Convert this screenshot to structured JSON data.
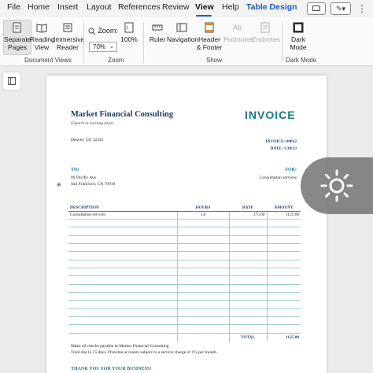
{
  "menu": {
    "items": [
      "File",
      "Home",
      "Insert",
      "Layout",
      "References",
      "Review",
      "View",
      "Help",
      "Table Design"
    ],
    "active": "View"
  },
  "ribbon": {
    "separate_pages": "Separate Pages",
    "reading_view": "Reading View",
    "immersive_reader": "Immersive Reader",
    "zoom": "Zoom:",
    "zoom_100": "100%",
    "zoom_value": "70%",
    "ruler": "Ruler",
    "navigation": "Navigation",
    "header_footer": "Header & Footer",
    "footnotes": "Footnotes",
    "endnotes": "Endnotes",
    "dark_mode": "Dark Mode",
    "groups": {
      "document_views": "Document Views",
      "zoom": "Zoom",
      "show": "Show",
      "dark_mode": "Dark Mode"
    }
  },
  "invoice": {
    "company": "Market Financial Consulting",
    "tagline": "Experts in earning trusts",
    "title": "INVOICE",
    "address": "Denver, CO 12345",
    "invoice_no": "INVOICE: 00012",
    "date": "DATE: 1/30/23",
    "to_label": "TO:",
    "to_line1": "89 Pacific Ave",
    "to_line2": "San Francisco, CA 78910",
    "for_label": "FOR:",
    "for_line": "Consultation services",
    "columns": [
      "DESCRIPTION",
      "HOURS",
      "RATE",
      "AMOUNT"
    ],
    "rows": [
      {
        "description": "Consultation services",
        "hours": "3.0",
        "rate": "375.00",
        "amount": "1125.00"
      }
    ],
    "total_label": "TOTAL",
    "total_value": "1125.00",
    "note1": "Make all checks payable to Market Financial Consulting",
    "note2": "Total due in 15 days. Overdue accounts subject to a service charge of 1% per month.",
    "thanks": "THANK YOU FOR YOUR BUSINESS!"
  },
  "colors": {
    "accent": "#185abd",
    "invoice_teal": "#1a7a84",
    "company_navy": "#1f3c5f"
  }
}
